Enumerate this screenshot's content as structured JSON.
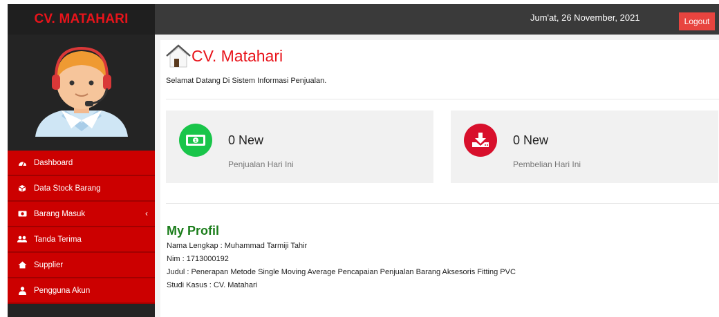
{
  "header": {
    "brand": "CV. MATAHARI",
    "date": "Jum'at, 26 November, 2021",
    "logout_label": "Logout"
  },
  "sidebar": {
    "items": [
      {
        "label": "Dashboard",
        "icon": "dashboard-icon"
      },
      {
        "label": "Data Stock Barang",
        "icon": "cube-icon"
      },
      {
        "label": "Barang Masuk",
        "icon": "money-icon"
      },
      {
        "label": "Tanda Terima",
        "icon": "users-icon"
      },
      {
        "label": "Supplier",
        "icon": "home-icon"
      },
      {
        "label": "Pengguna Akun",
        "icon": "user-icon"
      }
    ]
  },
  "main": {
    "title": "CV. Matahari",
    "welcome": "Selamat Datang Di Sistem Informasi Penjualan.",
    "cards": [
      {
        "count": "0 New",
        "label": "Penjualan Hari Ini",
        "icon": "money-icon",
        "color": "#19c54a"
      },
      {
        "count": "0 New",
        "label": "Pembelian Hari Ini",
        "icon": "download-icon",
        "color": "#d8102c"
      }
    ],
    "profile": {
      "title": "My Profil",
      "nama": "Nama Lengkap : Muhammad Tarmiji Tahir",
      "nim": "Nim : 1713000192",
      "judul": "Judul : Penerapan Metode Single Moving Average Pencapaian Penjualan Barang Aksesoris Fitting PVC",
      "studi": "Studi Kasus : CV. Matahari"
    }
  },
  "colors": {
    "brand_red": "#e8141b",
    "menu_red": "#cc0000",
    "profile_green": "#1b7d1b"
  }
}
